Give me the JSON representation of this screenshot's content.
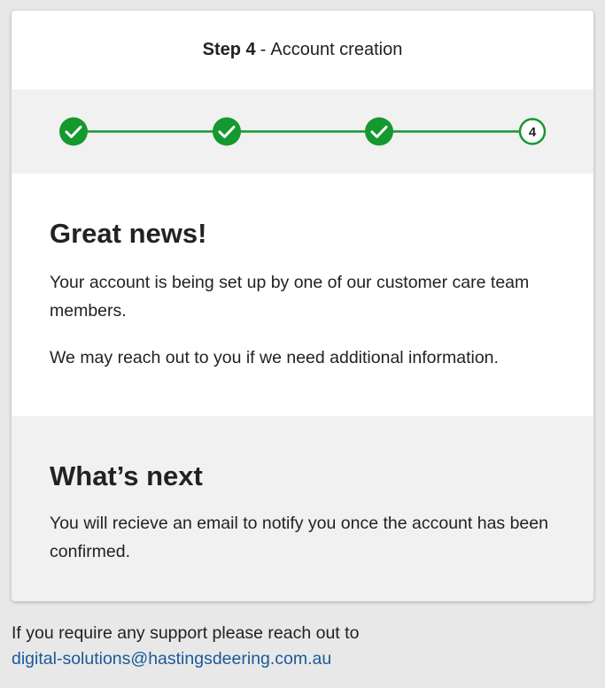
{
  "header": {
    "step_label": "Step 4",
    "separator": "-",
    "title": "Account creation"
  },
  "stepper": {
    "accent_color": "#15992f",
    "steps": [
      {
        "state": "completed",
        "icon": "check-icon"
      },
      {
        "state": "completed",
        "icon": "check-icon"
      },
      {
        "state": "completed",
        "icon": "check-icon"
      },
      {
        "state": "current",
        "number": "4"
      }
    ]
  },
  "great_news": {
    "heading": "Great news!",
    "paragraph_1": "Your account is being set up by one of our customer care team members.",
    "paragraph_2": "We may reach out to you if we need additional information."
  },
  "whats_next": {
    "heading": "What’s next",
    "paragraph": "You will recieve an email to notify you once the account has been confirmed."
  },
  "footer": {
    "support_text": "If you require any support please reach out to",
    "email_link": "digital-solutions@hastingsdeering.com.au",
    "link_color": "#1a5a9a"
  }
}
